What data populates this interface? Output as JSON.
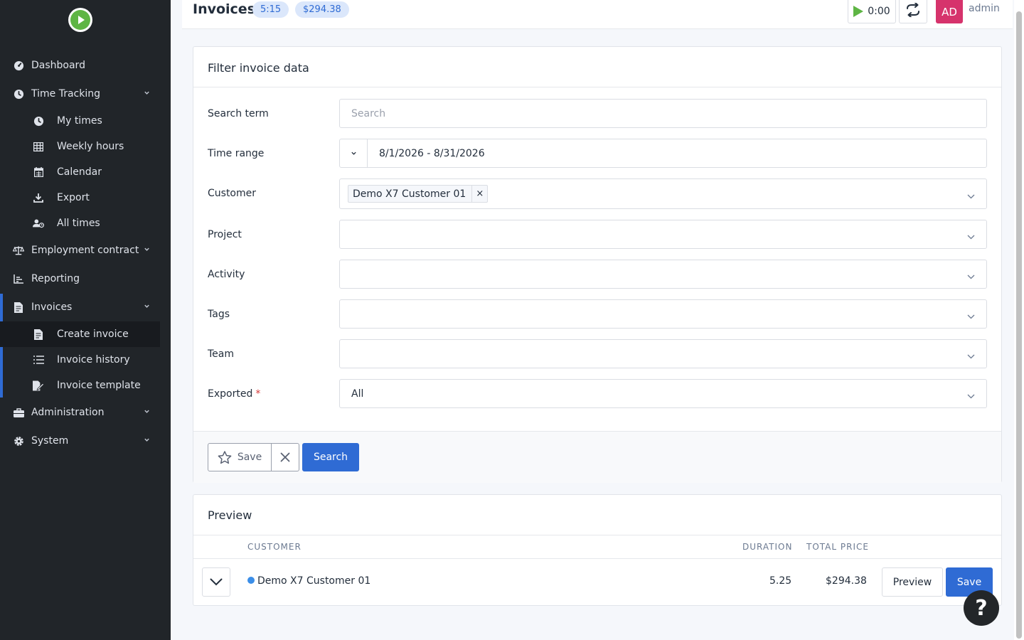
{
  "sidebar": {
    "items": [
      {
        "label": "Dashboard",
        "icon": "dashboard-icon"
      },
      {
        "label": "Time Tracking",
        "icon": "clock-icon"
      },
      {
        "label": "My times",
        "icon": "clock-icon"
      },
      {
        "label": "Weekly hours",
        "icon": "table-icon"
      },
      {
        "label": "Calendar",
        "icon": "calendar-icon"
      },
      {
        "label": "Export",
        "icon": "download-icon"
      },
      {
        "label": "All times",
        "icon": "users-clock-icon"
      },
      {
        "label": "Employment contract",
        "icon": "scale-icon"
      },
      {
        "label": "Reporting",
        "icon": "chart-icon"
      },
      {
        "label": "Invoices",
        "icon": "file-invoice-icon"
      },
      {
        "label": "Create invoice",
        "icon": "file-icon"
      },
      {
        "label": "Invoice history",
        "icon": "list-icon"
      },
      {
        "label": "Invoice template",
        "icon": "file-edit-icon"
      },
      {
        "label": "Administration",
        "icon": "toolbox-icon"
      },
      {
        "label": "System",
        "icon": "gear-icon"
      }
    ]
  },
  "header": {
    "title": "Invoices",
    "badge_duration": "5:15",
    "badge_price": "$294.38",
    "timer": "0:00",
    "avatar": "AD",
    "username": "admin"
  },
  "filter": {
    "title": "Filter invoice data",
    "search_label": "Search term",
    "search_placeholder": "Search",
    "time_range_label": "Time range",
    "time_range_value": "8/1/2026 - 8/31/2026",
    "customer_label": "Customer",
    "customer_tag": "Demo X7 Customer 01",
    "project_label": "Project",
    "activity_label": "Activity",
    "tags_label": "Tags",
    "team_label": "Team",
    "exported_label": "Exported",
    "exported_required": "*",
    "exported_value": "All",
    "save_label": "Save",
    "search_button": "Search"
  },
  "preview": {
    "title": "Preview",
    "columns": [
      "CUSTOMER",
      "DURATION",
      "TOTAL PRICE"
    ],
    "row": {
      "customer": "Demo X7 Customer 01",
      "duration": "5.25",
      "total": "$294.38",
      "color": "#3b8ee8"
    },
    "preview_button": "Preview",
    "save_button": "Save"
  },
  "help": {
    "label": "?"
  },
  "colors": {
    "primary": "#2f6bd4",
    "sidebar": "#212529",
    "avatar": "#d6336c",
    "play": "#5eb544"
  }
}
